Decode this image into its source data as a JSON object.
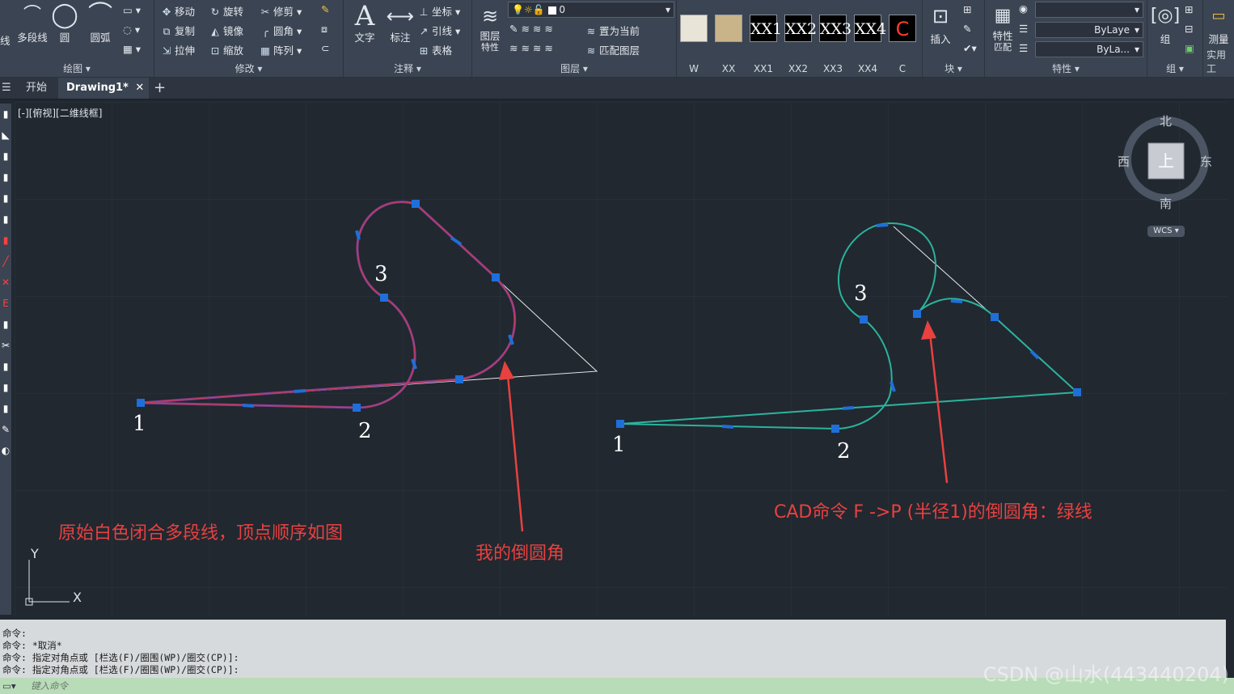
{
  "ribbon": {
    "draw": {
      "title": "绘图",
      "polyline": "多段线",
      "circle": "圆",
      "arc": "圆弧",
      "line_partial": "线"
    },
    "modify": {
      "title": "修改",
      "move": "移动",
      "rotate": "旋转",
      "trim": "修剪",
      "copy": "复制",
      "mirror": "镜像",
      "fillet": "圆角",
      "stretch": "拉伸",
      "scale": "缩放",
      "array": "阵列"
    },
    "annotation": {
      "title": "注释",
      "text": "文字",
      "dimension": "标注",
      "coordinate": "坐标",
      "leader": "引线",
      "table": "表格"
    },
    "layers": {
      "title": "图层",
      "layer_props_line1": "图层",
      "layer_props_line2": "特性",
      "current_layer": "0",
      "set_current": "置为当前",
      "match_layer": "匹配图层"
    },
    "blocks_strip": [
      {
        "icon": "W",
        "label": "W",
        "kind": "image"
      },
      {
        "icon": "XX",
        "label": "XX",
        "kind": "image"
      },
      {
        "icon": "XX1",
        "label": "XX1",
        "kind": "text"
      },
      {
        "icon": "XX2",
        "label": "XX2",
        "kind": "text"
      },
      {
        "icon": "XX3",
        "label": "XX3",
        "kind": "text"
      },
      {
        "icon": "XX4",
        "label": "XX4",
        "kind": "text"
      },
      {
        "icon": "C",
        "label": "C",
        "kind": "red"
      }
    ],
    "block": {
      "title": "块",
      "insert": "插入"
    },
    "properties": {
      "title": "特性",
      "match_line1": "特性",
      "match_line2": "匹配",
      "linetype": "ByLaye",
      "lineweight": "ByLa..."
    },
    "groups": {
      "title": "组",
      "group": "组"
    },
    "utilities": {
      "title": "实用工",
      "measure": "测量"
    }
  },
  "tabs": {
    "start": "开始",
    "drawing": "Drawing1*"
  },
  "viewport": {
    "label": "[-][俯视][二维线框]"
  },
  "compass": {
    "north": "北",
    "south": "南",
    "east": "东",
    "west": "西",
    "top": "上",
    "wcs": "WCS"
  },
  "drawing": {
    "left_labels": {
      "v1": "1",
      "v2": "2",
      "v3": "3"
    },
    "right_labels": {
      "v1": "1",
      "v2": "2",
      "v3": "3"
    },
    "caption_original": "原始白色闭合多段线，顶点顺序如图",
    "caption_mine": "我的倒圆角",
    "caption_cad": "CAD命令 F ->P (半径1)的倒圆角：绿线",
    "colors": {
      "annotation_red": "#e8413f",
      "purple_curve": "#7d3f8e",
      "teal_curve": "#2bb39c",
      "grip_blue": "#1e6fd9",
      "white_poly": "#e8e8e8"
    }
  },
  "ucs": {
    "x": "X",
    "y": "Y"
  },
  "command": {
    "lines": [
      "命令:",
      "命令: *取消*",
      "命令: 指定对角点或 [栏选(F)/圈围(WP)/圈交(CP)]:",
      "命令: 指定对角点或 [栏选(F)/圈围(WP)/圈交(CP)]:"
    ],
    "placeholder": "键入命令"
  },
  "watermark": "CSDN @山水(443440204)"
}
